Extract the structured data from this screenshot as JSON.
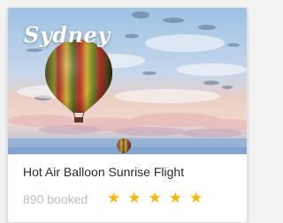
{
  "card": {
    "city": "Sydney",
    "title": "Hot Air Balloon Sunrise Flight",
    "booked": "890 booked",
    "rating": 5,
    "rating_max": 5,
    "star_color": "#f5b80b",
    "photo": {
      "subject": "hot air balloons in a sunrise sky",
      "icons": [
        "hot-air-balloon-large",
        "hot-air-balloon-small"
      ]
    }
  }
}
